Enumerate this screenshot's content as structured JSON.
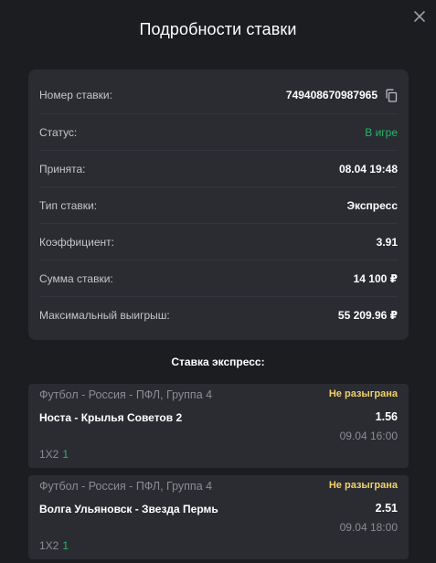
{
  "modal": {
    "title": "Подробности ставки"
  },
  "details": [
    {
      "label": "Номер ставки:",
      "value": "749408670987965"
    },
    {
      "label": "Статус:",
      "value": "В игре"
    },
    {
      "label": "Принята:",
      "value": "08.04 19:48"
    },
    {
      "label": "Тип ставки:",
      "value": "Экспресс"
    },
    {
      "label": "Коэффициент:",
      "value": "3.91"
    },
    {
      "label": "Сумма ставки:",
      "value": "14 100 ₽"
    },
    {
      "label": "Максимальный выигрыш:",
      "value": "55 209.96 ₽"
    }
  ],
  "colors": {
    "status_active": "#25b66b",
    "status_pending": "#f2d16b",
    "background": "#1c1d21",
    "card": "#2a2c31"
  },
  "section": {
    "title": "Ставка экспресс:"
  },
  "events": [
    {
      "league": "Футбол - Россия - ПФЛ, Группа 4",
      "status": "Не разыграна",
      "teams": "Носта - Крылья Советов 2",
      "odds": "1.56",
      "datetime": "09.04 16:00",
      "market": "1X2",
      "outcome": "1"
    },
    {
      "league": "Футбол - Россия - ПФЛ, Группа 4",
      "status": "Не разыграна",
      "teams": "Волга Ульяновск - Звезда Пермь",
      "odds": "2.51",
      "datetime": "09.04 18:00",
      "market": "1X2",
      "outcome": "1"
    }
  ]
}
